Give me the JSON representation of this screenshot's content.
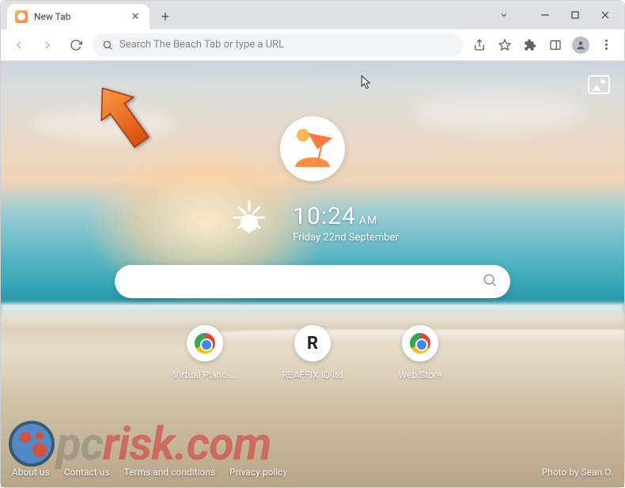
{
  "tab": {
    "title": "New Tab"
  },
  "omnibox": {
    "placeholder": "Search The Beach Tab or type a URL"
  },
  "clock": {
    "time": "10:24",
    "ampm": "AM",
    "date": "Friday 22nd September"
  },
  "search": {
    "placeholder": ""
  },
  "shortcuts": [
    {
      "label": "Virtual Piano ...",
      "icon": "chrome"
    },
    {
      "label": "REAFFIX IO ltd",
      "icon": "letter",
      "letter": "R"
    },
    {
      "label": "Web Store",
      "icon": "chrome"
    }
  ],
  "footer": {
    "links": [
      "About us",
      "Contact us",
      "Terms and conditions",
      "Privacy policy"
    ],
    "credit": "Photo by Sean O."
  },
  "watermark": {
    "left": "pc",
    "right": "risk.com"
  }
}
